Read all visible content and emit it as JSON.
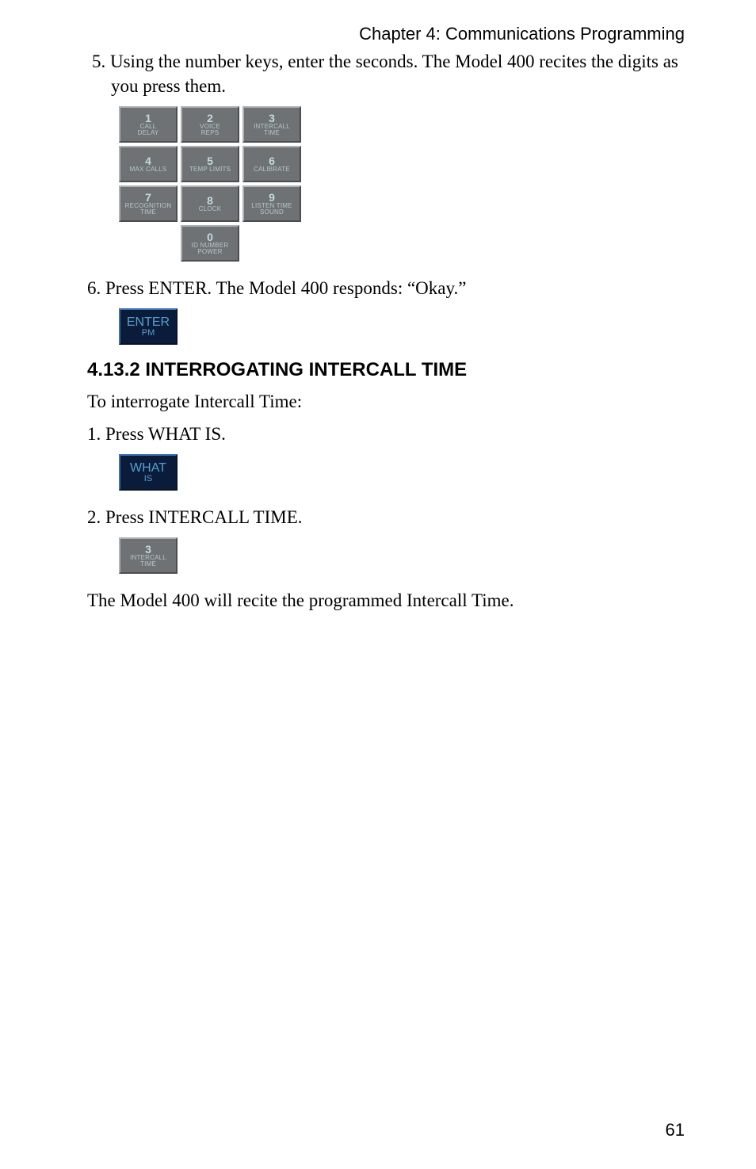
{
  "chapter": "Chapter 4: Communications Programming",
  "step5": "5. Using the number keys, enter the seconds. The Model 400 recites the digits as you press them.",
  "keypad": {
    "k1": {
      "num": "1",
      "lbl1": "CALL",
      "lbl2": "DELAY"
    },
    "k2": {
      "num": "2",
      "lbl1": "VOICE",
      "lbl2": "REPS"
    },
    "k3": {
      "num": "3",
      "lbl1": "INTERCALL",
      "lbl2": "TIME"
    },
    "k4": {
      "num": "4",
      "lbl1": "MAX CALLS"
    },
    "k5": {
      "num": "5",
      "lbl1": "TEMP LIMITS"
    },
    "k6": {
      "num": "6",
      "lbl1": "CALIBRATE"
    },
    "k7": {
      "num": "7",
      "lbl1": "RECOGNITION",
      "lbl2": "TIME"
    },
    "k8": {
      "num": "8",
      "lbl1": "CLOCK"
    },
    "k9": {
      "num": "9",
      "lbl1": "LISTEN TIME",
      "lbl2": "SOUND"
    },
    "k0": {
      "num": "0",
      "lbl1": "ID NUMBER",
      "lbl2": "POWER"
    }
  },
  "step6": "6. Press ENTER. The Model 400 responds: “Okay.”",
  "enter_key": {
    "big": "ENTER",
    "sub": "PM"
  },
  "heading": "4.13.2 INTERROGATING INTERCALL TIME",
  "intro": "To interrogate Intercall Time:",
  "step1": "1. Press WHAT IS.",
  "whatis_key": {
    "big": "WHAT",
    "sub": "IS"
  },
  "step2": "2. Press INTERCALL TIME.",
  "intercall_key": {
    "num": "3",
    "lbl1": "INTERCALL",
    "lbl2": "TIME"
  },
  "closing": "The Model 400 will recite the programmed Intercall Time.",
  "page_number": "61"
}
